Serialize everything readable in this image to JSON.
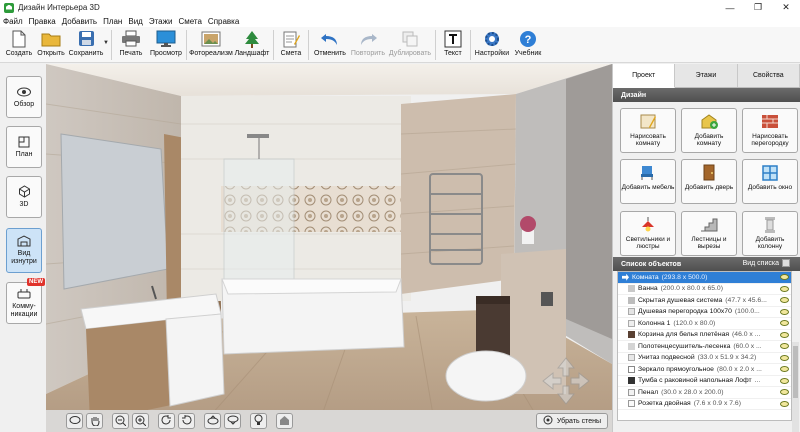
{
  "window": {
    "title": "Дизайн Интерьера 3D",
    "minimize": "—",
    "maximize": "❐",
    "close": "✕"
  },
  "menu": [
    "Файл",
    "Правка",
    "Добавить",
    "План",
    "Вид",
    "Этажи",
    "Смета",
    "Справка"
  ],
  "toolbar": {
    "create": "Создать",
    "open": "Открыть",
    "save": "Сохранить",
    "print": "Печать",
    "preview": "Просмотр",
    "photorealism": "Фотореализм",
    "landscape": "Ландшафт",
    "estimate": "Смета",
    "undo": "Отменить",
    "redo": "Повторить",
    "duplicate": "Дублировать",
    "text": "Текст",
    "settings": "Настройки",
    "tutorial": "Учебник"
  },
  "left_nav": {
    "overview": "Обзор",
    "plan": "План",
    "view3d": "3D",
    "interior": "Вид изнутри",
    "comms": "Комму-никации",
    "new_badge": "NEW"
  },
  "tabs": [
    "Проект",
    "Этажи",
    "Свойства"
  ],
  "design": {
    "header": "Дизайн",
    "buttons": [
      "Нарисовать комнату",
      "Добавить комнату",
      "Нарисовать перегородку",
      "Добавить мебель",
      "Добавить дверь",
      "Добавить окно",
      "Светильники и люстры",
      "Лестницы и вырезы",
      "Добавить колонну"
    ]
  },
  "objects": {
    "header": "Список объектов",
    "view_list": "Вид списка",
    "items": [
      {
        "name": "Комната",
        "dims": "(293.8 x 500.0)"
      },
      {
        "name": "Ванна",
        "dims": "(200.0 x 80.0 x 65.0)"
      },
      {
        "name": "Скрытая душевая система",
        "dims": "(47.7 x 45.6..."
      },
      {
        "name": "Душевая перегородка 100х70",
        "dims": "(100.0..."
      },
      {
        "name": "Колонна 1",
        "dims": "(120.0 x 80.0)"
      },
      {
        "name": "Корзина для белья плетёная",
        "dims": "(46.0 x ..."
      },
      {
        "name": "Полотенцесушитель-лесенка",
        "dims": "(60.0 x ..."
      },
      {
        "name": "Унитаз подвесной",
        "dims": "(33.0 x 51.9 x 34.2)"
      },
      {
        "name": "Зеркало прямоугольное",
        "dims": "(80.0 x 2.0 x ..."
      },
      {
        "name": "Тумба с раковиной напольная Лофт",
        "dims": "..."
      },
      {
        "name": "Пенал",
        "dims": "(30.0 x 28.0 x 200.0)"
      },
      {
        "name": "Розетка двойная",
        "dims": "(7.6 x 0.9 x 7.6)"
      }
    ]
  },
  "viewport": {
    "remove_walls": "Убрать стены"
  },
  "colors": {
    "accent": "#2f7fd6",
    "panel_header": "#5a5a5a",
    "nav_active": "#cde3f7"
  }
}
